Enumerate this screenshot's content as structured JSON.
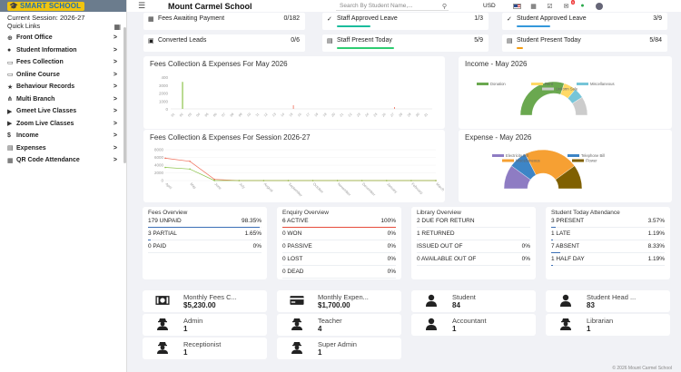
{
  "sidebar": {
    "logo_text": "SMART SCHOOL",
    "session_label": "Current Session: 2026-27",
    "quick_links": "Quick Links",
    "items": [
      {
        "label": "Front Office",
        "icon": "globe-icon"
      },
      {
        "label": "Student Information",
        "icon": "user-icon"
      },
      {
        "label": "Fees Collection",
        "icon": "money-icon"
      },
      {
        "label": "Online Course",
        "icon": "laptop-icon"
      },
      {
        "label": "Behaviour Records",
        "icon": "star-icon"
      },
      {
        "label": "Multi Branch",
        "icon": "branch-icon"
      },
      {
        "label": "Gmeet Live Classes",
        "icon": "video-icon"
      },
      {
        "label": "Zoom Live Classes",
        "icon": "video-icon"
      },
      {
        "label": "Income",
        "icon": "income-icon"
      },
      {
        "label": "Expenses",
        "icon": "expense-icon"
      },
      {
        "label": "QR Code Attendance",
        "icon": "qr-icon"
      }
    ]
  },
  "topbar": {
    "school_name": "Mount Carmel School",
    "search_placeholder": "Search By Student Name,...",
    "currency": "USD",
    "notification_count": "9"
  },
  "stat_cards": [
    {
      "label": "Fees Awaiting Payment",
      "value": "0/182",
      "color": "#e74c3c",
      "fill": 0
    },
    {
      "label": "Staff Approved Leave",
      "value": "1/3",
      "color": "#1abc9c",
      "fill": 0.33
    },
    {
      "label": "Student Approved Leave",
      "value": "3/9",
      "color": "#3498db",
      "fill": 0.33
    },
    {
      "label": "Converted Leads",
      "value": "0/6",
      "color": "#e74c3c",
      "fill": 0
    },
    {
      "label": "Staff Present Today",
      "value": "5/9",
      "color": "#2ecc71",
      "fill": 0.56
    },
    {
      "label": "Student Present Today",
      "value": "5/84",
      "color": "#f39c12",
      "fill": 0.06
    }
  ],
  "panels": {
    "fees_month_title": "Fees Collection & Expenses For May 2026",
    "income_title": "Income - May 2026",
    "fees_session_title": "Fees Collection & Expenses For Session 2026-27",
    "expense_title": "Expense - May 2026"
  },
  "chart_data": [
    {
      "type": "bar",
      "title": "Fees Collection & Expenses For May 2026",
      "categories": [
        "01",
        "02",
        "03",
        "04",
        "05",
        "06",
        "07",
        "08",
        "09",
        "10",
        "11",
        "12",
        "13",
        "14",
        "15",
        "16",
        "17",
        "18",
        "19",
        "20",
        "21",
        "22",
        "23",
        "24",
        "25",
        "26",
        "27",
        "28",
        "29",
        "30",
        "31"
      ],
      "y_ticks": [
        "400",
        "3000",
        "2000",
        "1000",
        "0"
      ],
      "ylim": [
        0,
        4000
      ],
      "series": [
        {
          "color": "#8bc34a",
          "values": [
            0,
            3400,
            0,
            0,
            0,
            0,
            0,
            0,
            0,
            0,
            0,
            0,
            0,
            0,
            0,
            0,
            0,
            0,
            0,
            0,
            0,
            0,
            0,
            0,
            0,
            0,
            0,
            0,
            0,
            0,
            0
          ]
        },
        {
          "color": "#ef6c57",
          "values": [
            0,
            0,
            0,
            0,
            0,
            0,
            0,
            0,
            0,
            0,
            0,
            0,
            0,
            0,
            0,
            0,
            0,
            0,
            0,
            0,
            0,
            0,
            0,
            0,
            0,
            0,
            0,
            0,
            0,
            0,
            0
          ]
        }
      ]
    },
    {
      "type": "pie",
      "title": "Income - May 2026",
      "legend": [
        {
          "name": "Donation",
          "color": "#6aa84f"
        },
        {
          "name": "Rent",
          "color": "#ffd966"
        },
        {
          "name": "Miscellaneous",
          "color": "#76c5d8"
        },
        {
          "name": "Uniform Sale",
          "color": "#cccccc"
        }
      ],
      "values": [
        60,
        12,
        10,
        18
      ]
    },
    {
      "type": "line",
      "title": "Fees Collection & Expenses For Session 2026-27",
      "categories": [
        "April",
        "May",
        "June",
        "July",
        "August",
        "September",
        "October",
        "November",
        "December",
        "January",
        "February",
        "March"
      ],
      "y_ticks": [
        "8000",
        "6000",
        "4000",
        "2000",
        "0"
      ],
      "ylim": [
        0,
        8000
      ],
      "series": [
        {
          "color": "#ef6c57",
          "values": [
            5800,
            5000,
            300,
            0,
            0,
            0,
            0,
            0,
            0,
            0,
            0,
            0
          ]
        },
        {
          "color": "#8bc34a",
          "values": [
            3400,
            3000,
            0,
            0,
            0,
            0,
            0,
            0,
            0,
            0,
            0,
            0
          ]
        }
      ]
    },
    {
      "type": "pie",
      "title": "Expense - May 2026",
      "legend": [
        {
          "name": "Electricity Bill",
          "color": "#8e7cc3"
        },
        {
          "name": "Telephone Bill",
          "color": "#3d85c6"
        },
        {
          "name": "Miscellaneous",
          "color": "#f6a033"
        },
        {
          "name": "Flower",
          "color": "#7f6000"
        }
      ],
      "values": [
        20,
        15,
        45,
        20
      ]
    }
  ],
  "overviews": [
    {
      "title": "Fees Overview",
      "rows": [
        {
          "label": "179 UNPAID",
          "value": "98.35%",
          "fill": 0.98,
          "color": "#3b6fb6"
        },
        {
          "label": "3 PARTIAL",
          "value": "1.65%",
          "fill": 0.02,
          "color": "#3b6fb6"
        },
        {
          "label": "0 PAID",
          "value": "0%",
          "fill": 0,
          "color": "#3b6fb6"
        }
      ]
    },
    {
      "title": "Enquiry Overview",
      "rows": [
        {
          "label": "6 ACTIVE",
          "value": "100%",
          "fill": 1,
          "color": "#e74c3c"
        },
        {
          "label": "0 WON",
          "value": "0%",
          "fill": 0,
          "color": "#e74c3c"
        },
        {
          "label": "0 PASSIVE",
          "value": "0%",
          "fill": 0,
          "color": "#e74c3c"
        },
        {
          "label": "0 LOST",
          "value": "0%",
          "fill": 0,
          "color": "#e74c3c"
        },
        {
          "label": "0 DEAD",
          "value": "0%",
          "fill": 0,
          "color": "#e74c3c"
        }
      ]
    },
    {
      "title": "Library Overview",
      "rows": [
        {
          "label": "2 DUE FOR RETURN",
          "value": "",
          "fill": 0,
          "color": "#2ecc71"
        },
        {
          "label": "1 RETURNED",
          "value": "",
          "fill": 0,
          "color": "#2ecc71"
        },
        {
          "label": "ISSUED OUT OF",
          "value": "0%",
          "fill": 0,
          "color": "#2ecc71"
        },
        {
          "label": "0 AVAILABLE OUT OF",
          "value": "0%",
          "fill": 0,
          "color": "#2ecc71"
        }
      ]
    },
    {
      "title": "Student Today Attendance",
      "rows": [
        {
          "label": "3 PRESENT",
          "value": "3.57%",
          "fill": 0.036,
          "color": "#3b6fb6"
        },
        {
          "label": "1 LATE",
          "value": "1.19%",
          "fill": 0.012,
          "color": "#3b6fb6"
        },
        {
          "label": "7 ABSENT",
          "value": "8.33%",
          "fill": 0.083,
          "color": "#3b6fb6"
        },
        {
          "label": "1 HALF DAY",
          "value": "1.19%",
          "fill": 0.012,
          "color": "#3b6fb6"
        }
      ]
    }
  ],
  "info_cards": [
    {
      "label": "Monthly Fees C...",
      "value": "$5,230.00",
      "icon": "cash-icon"
    },
    {
      "label": "Monthly Expen...",
      "value": "$1,700.00",
      "icon": "credit-card-icon"
    },
    {
      "label": "Student",
      "value": "84",
      "icon": "user-icon"
    },
    {
      "label": "Student Head ...",
      "value": "83",
      "icon": "user-icon"
    },
    {
      "label": "Admin",
      "value": "1",
      "icon": "user-secret-icon"
    },
    {
      "label": "Teacher",
      "value": "4",
      "icon": "user-secret-icon"
    },
    {
      "label": "Accountant",
      "value": "1",
      "icon": "user-icon"
    },
    {
      "label": "Librarian",
      "value": "1",
      "icon": "user-secret-icon"
    },
    {
      "label": "Receptionist",
      "value": "1",
      "icon": "user-secret-icon"
    },
    {
      "label": "Super Admin",
      "value": "1",
      "icon": "user-secret-icon"
    }
  ],
  "footer": "© 2026 Mount Carmel School"
}
